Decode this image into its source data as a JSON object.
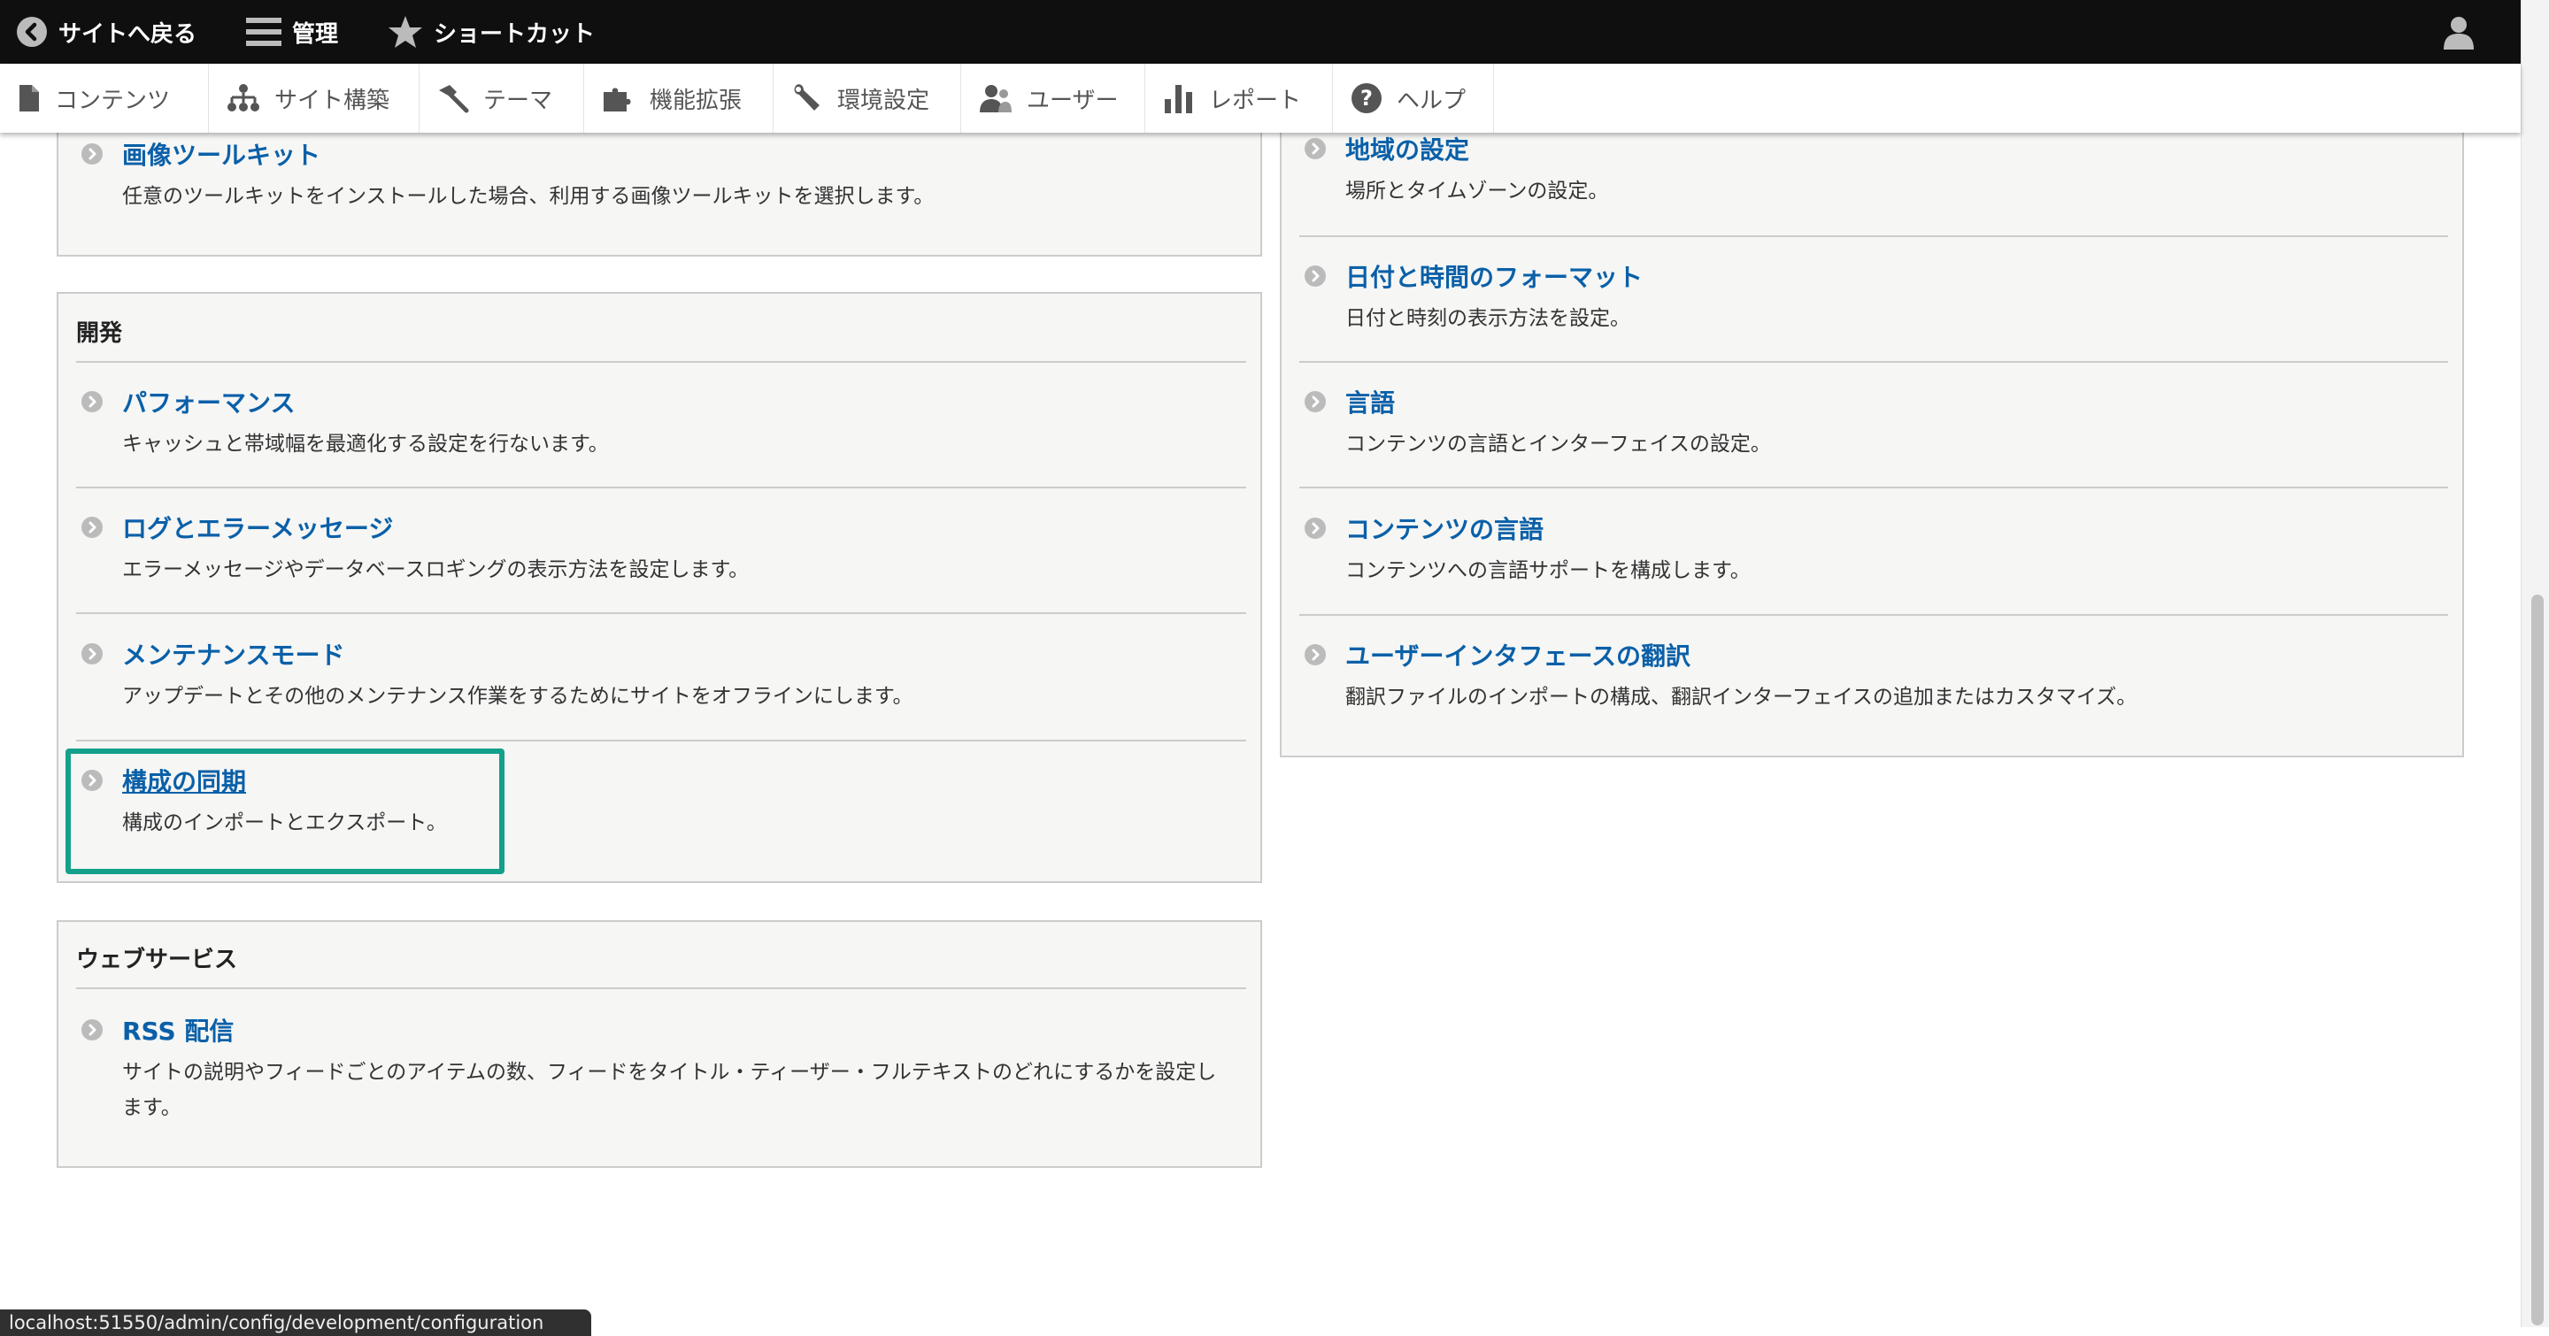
{
  "toolbar": {
    "back_label": "サイトへ戻る",
    "manage_label": "管理",
    "shortcuts_label": "ショートカット"
  },
  "tray": {
    "items": [
      {
        "label": "コンテンツ",
        "icon": "file-icon"
      },
      {
        "label": "サイト構築",
        "icon": "sitemap-icon"
      },
      {
        "label": "テーマ",
        "icon": "paintbrush-icon"
      },
      {
        "label": "機能拡張",
        "icon": "puzzle-icon"
      },
      {
        "label": "環境設定",
        "icon": "wrench-icon"
      },
      {
        "label": "ユーザー",
        "icon": "people-icon"
      },
      {
        "label": "レポート",
        "icon": "bar-chart-icon"
      },
      {
        "label": "ヘルプ",
        "icon": "help-icon"
      }
    ]
  },
  "left": {
    "top_panel": {
      "items": [
        {
          "title": "画像ツールキット",
          "desc": "任意のツールキットをインストールした場合、利用する画像ツールキットを選択します。"
        }
      ]
    },
    "development": {
      "title": "開発",
      "items": [
        {
          "title": "パフォーマンス",
          "desc": "キャッシュと帯域幅を最適化する設定を行ないます。"
        },
        {
          "title": "ログとエラーメッセージ",
          "desc": "エラーメッセージやデータベースロギングの表示方法を設定します。"
        },
        {
          "title": "メンテナンスモード",
          "desc": "アップデートとその他のメンテナンス作業をするためにサイトをオフラインにします。"
        },
        {
          "title": "構成の同期",
          "desc": "構成のインポートとエクスポート。"
        }
      ]
    },
    "web_services": {
      "title": "ウェブサービス",
      "items": [
        {
          "title": "RSS 配信",
          "desc": "サイトの説明やフィードごとのアイテムの数、フィードをタイトル・ティーザー・フルテキストのどれにするかを設定します。"
        }
      ]
    }
  },
  "right": {
    "regional": {
      "items": [
        {
          "title": "地域の設定",
          "desc": "場所とタイムゾーンの設定。"
        },
        {
          "title": "日付と時間のフォーマット",
          "desc": "日付と時刻の表示方法を設定。"
        },
        {
          "title": "言語",
          "desc": "コンテンツの言語とインターフェイスの設定。"
        },
        {
          "title": "コンテンツの言語",
          "desc": "コンテンツへの言語サポートを構成します。"
        },
        {
          "title": "ユーザーインタフェースの翻訳",
          "desc": "翻訳ファイルのインポートの構成、翻訳インターフェイスの追加またはカスタマイズ。"
        }
      ]
    }
  },
  "status_bar": {
    "url": "localhost:51550/admin/config/development/configuration"
  },
  "colors": {
    "toolbar_bg": "#0f0f0f",
    "link": "#0a60a8",
    "highlight": "#14a08a",
    "panel_bg": "#f6f6f5"
  }
}
